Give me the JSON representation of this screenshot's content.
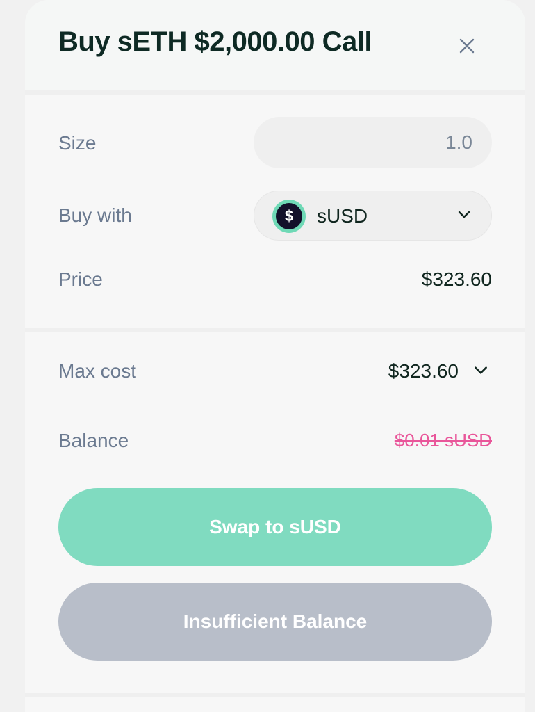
{
  "modal": {
    "title": "Buy sETH $2,000.00 Call",
    "close_icon": "close-icon"
  },
  "form": {
    "size_label": "Size",
    "size_value": "1.0",
    "buy_with_label": "Buy with",
    "buy_with_token": "sUSD",
    "buy_with_token_icon": "dollar-coin-icon",
    "price_label": "Price",
    "price_value": "$323.60"
  },
  "summary": {
    "max_cost_label": "Max cost",
    "max_cost_value": "$323.60",
    "balance_label": "Balance",
    "balance_value": "$0.01 sUSD"
  },
  "actions": {
    "swap_label": "Swap to sUSD",
    "insufficient_label": "Insufficient Balance"
  },
  "colors": {
    "accent": "#80dbc0",
    "error": "#e9569a",
    "disabled": "#b8bec9",
    "title_text": "#0e2a24",
    "label_text": "#6b7a90"
  }
}
